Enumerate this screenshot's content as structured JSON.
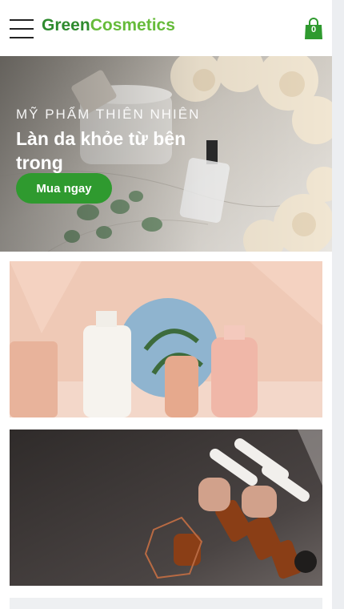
{
  "header": {
    "logo_part1": "Green",
    "logo_part2": "Cosmetics",
    "cart_count": "0",
    "menu_icon": "hamburger-menu-icon",
    "cart_icon": "shopping-bag-icon"
  },
  "hero": {
    "subtitle": "MỸ PHẨM THIÊN NHIÊN",
    "title": "Làn da khỏe từ bên trong",
    "button_label": "Mua ngay"
  },
  "colors": {
    "brand_dark_green": "#2e8b2e",
    "brand_light_green": "#66bb3a",
    "button_green": "#2f9a2f"
  }
}
